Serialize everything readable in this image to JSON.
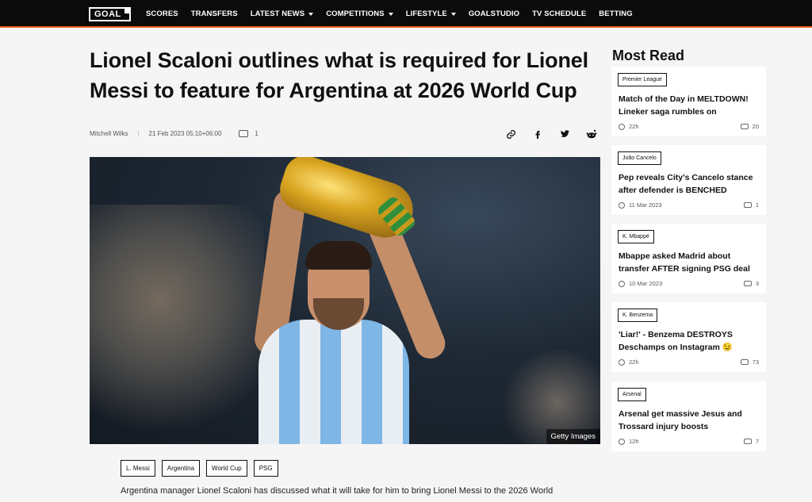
{
  "nav": {
    "logo": "GOAL",
    "items": [
      {
        "label": "SCORES",
        "dropdown": false
      },
      {
        "label": "TRANSFERS",
        "dropdown": false
      },
      {
        "label": "LATEST NEWS",
        "dropdown": true
      },
      {
        "label": "COMPETITIONS",
        "dropdown": true
      },
      {
        "label": "LIFESTYLE",
        "dropdown": true
      },
      {
        "label": "GOALSTUDIO",
        "dropdown": false
      },
      {
        "label": "TV SCHEDULE",
        "dropdown": false
      },
      {
        "label": "BETTING",
        "dropdown": false
      }
    ]
  },
  "article": {
    "title": "Lionel Scaloni outlines what is required for Lionel Messi to feature for Argentina at 2026 World Cup",
    "author": "Mitchell Wilks",
    "date": "21 Feb 2023 05:10+06:00",
    "comments": "1",
    "image_credit": "Getty Images",
    "tags": [
      "L. Messi",
      "Argentina",
      "World Cup",
      "PSG"
    ],
    "intro": "Argentina manager Lionel Scaloni has discussed what it will take for him to bring Lionel Messi to the 2026 World"
  },
  "share": {
    "icons": [
      "link-icon",
      "facebook-icon",
      "twitter-icon",
      "reddit-icon"
    ]
  },
  "sidebar": {
    "title": "Most Read",
    "cards": [
      {
        "label": "Premier League",
        "title": "Match of the Day in MELTDOWN! Lineker saga rumbles on",
        "time": "22h",
        "count": "20"
      },
      {
        "label": "João Cancelo",
        "title": "Pep reveals City's Cancelo stance after defender is BENCHED",
        "time": "11 Mar 2023",
        "count": "1"
      },
      {
        "label": "K. Mbappé",
        "title": "Mbappe asked Madrid about transfer AFTER signing PSG deal",
        "time": "10 Mar 2023",
        "count": "3"
      },
      {
        "label": "K. Benzema",
        "title": "'Liar!' - Benzema DESTROYS Deschamps on Instagram 😉",
        "time": "22h",
        "count": "73"
      },
      {
        "label": "Arsenal",
        "title": "Arsenal get massive Jesus and Trossard injury boosts",
        "time": "12h",
        "count": "7"
      }
    ]
  }
}
